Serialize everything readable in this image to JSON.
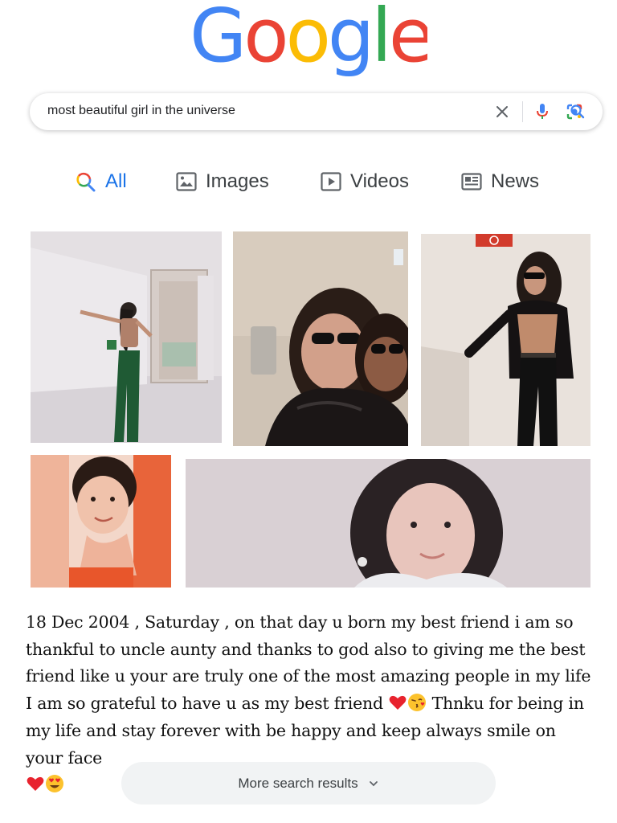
{
  "logo": {
    "letters": [
      {
        "char": "G",
        "color": "#4285F4"
      },
      {
        "char": "o",
        "color": "#EA4335"
      },
      {
        "char": "o",
        "color": "#FBBC05"
      },
      {
        "char": "g",
        "color": "#4285F4"
      },
      {
        "char": "l",
        "color": "#34A853"
      },
      {
        "char": "e",
        "color": "#EA4335"
      }
    ]
  },
  "search": {
    "query": "most beautiful girl in the universe",
    "icons": [
      "clear-icon",
      "microphone-icon",
      "lens-icon",
      "search-icon"
    ]
  },
  "tabs": [
    {
      "label": "All",
      "icon": "search-icon",
      "active": true
    },
    {
      "label": "Images",
      "icon": "image-icon",
      "active": false
    },
    {
      "label": "Videos",
      "icon": "play-icon",
      "active": false
    },
    {
      "label": "News",
      "icon": "newspaper-icon",
      "active": false
    }
  ],
  "images": [
    {
      "name": "image-result-1",
      "description": "woman in hallway by door"
    },
    {
      "name": "image-result-2",
      "description": "two women selfie with sunglasses"
    },
    {
      "name": "image-result-3",
      "description": "woman in black jacket by wall"
    },
    {
      "name": "image-result-4",
      "description": "smiling woman close-up"
    },
    {
      "name": "image-result-5",
      "description": "woman portrait smiling"
    }
  ],
  "caption": {
    "part1": "18 Dec 2004 , Saturday , on that day u born my best friend i am so thankful to uncle aunty and thanks to god also to giving me the best friend like u your are truly one of the most amazing people in my life I am so grateful to have u as my best friend ",
    "part2": " Thnku for being in my life and stay forever with be happy and keep always smile on your face",
    "emojis": [
      "red-heart-emoji",
      "kiss-emoji",
      "red-heart-emoji",
      "heart-eyes-emoji"
    ]
  },
  "more_button": {
    "label": "More search results"
  },
  "colors": {
    "accent": "#1a73e8",
    "tab_text": "#3c4043",
    "button_bg": "#f1f3f4"
  }
}
